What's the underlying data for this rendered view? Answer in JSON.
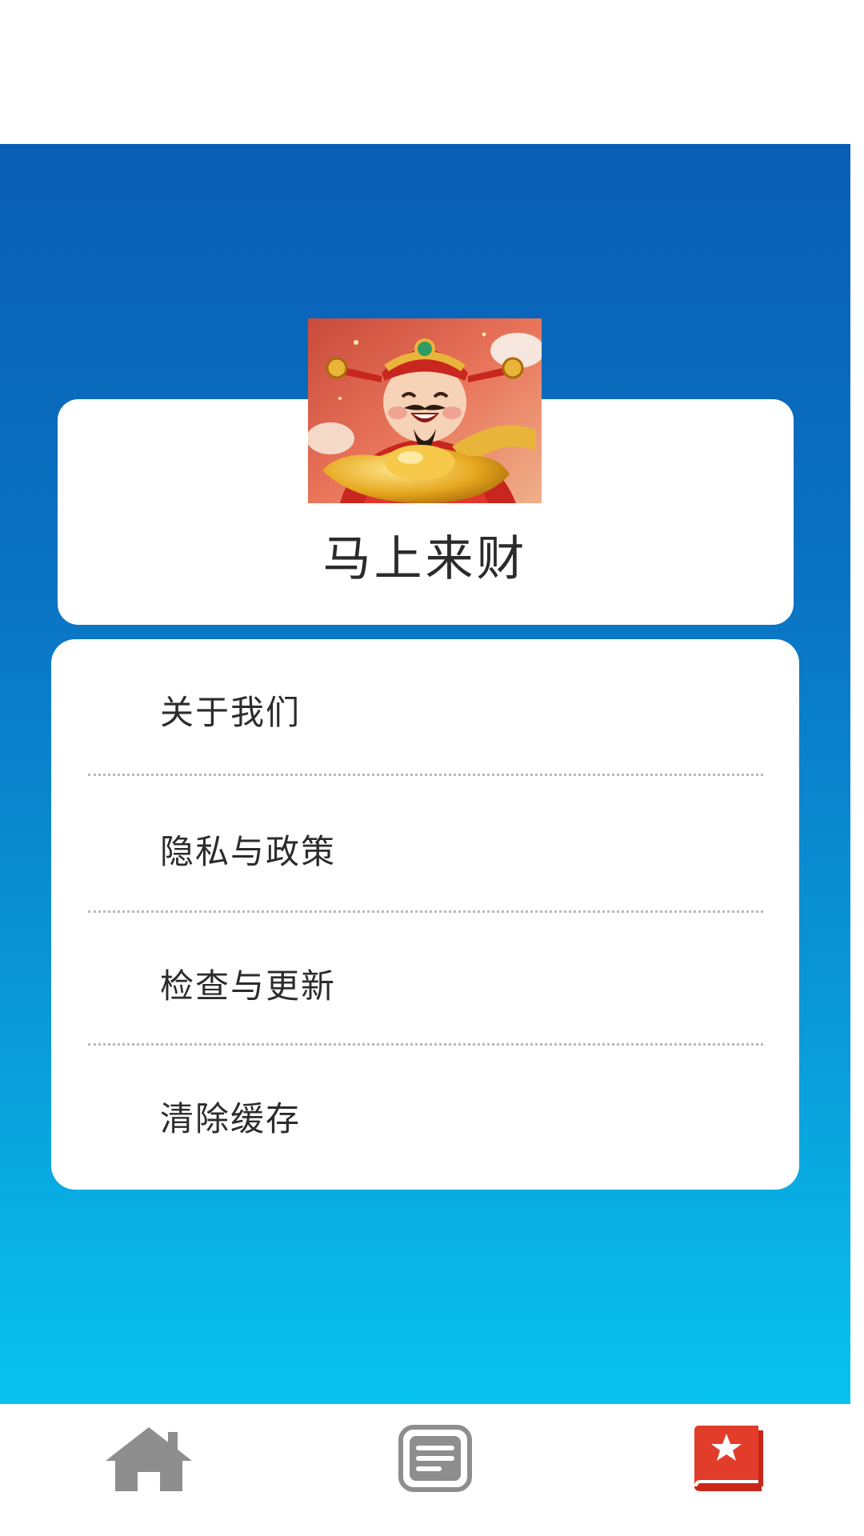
{
  "app": {
    "name": "马上来财",
    "avatar_icon": "god-of-wealth-avatar"
  },
  "menu": {
    "items": [
      {
        "label": "关于我们"
      },
      {
        "label": "隐私与政策"
      },
      {
        "label": "检查与更新"
      },
      {
        "label": "清除缓存"
      }
    ]
  },
  "tabbar": {
    "tabs": [
      {
        "icon": "home-icon",
        "active": false
      },
      {
        "icon": "document-icon",
        "active": false
      },
      {
        "icon": "favorites-book-icon",
        "active": true
      }
    ]
  },
  "colors": {
    "gradient_top": "#0a5eb4",
    "gradient_bottom": "#08c3ee",
    "inactive_icon": "#8e8e8e",
    "active_icon": "#e23c2a"
  }
}
